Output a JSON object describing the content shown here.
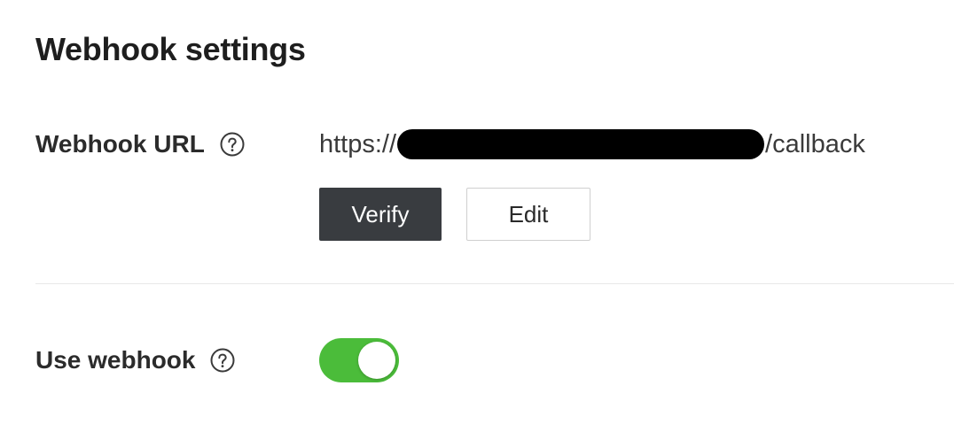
{
  "section": {
    "title": "Webhook settings"
  },
  "webhook_url": {
    "label": "Webhook URL",
    "help_icon": "question-circle-icon",
    "value_prefix": "https://",
    "value_suffix": "/callback",
    "verify_label": "Verify",
    "edit_label": "Edit"
  },
  "use_webhook": {
    "label": "Use webhook",
    "help_icon": "question-circle-icon",
    "enabled": true,
    "toggle_color": "#4bbc3a"
  },
  "colors": {
    "verify_button_bg": "#393c40",
    "redaction": "#000000"
  }
}
